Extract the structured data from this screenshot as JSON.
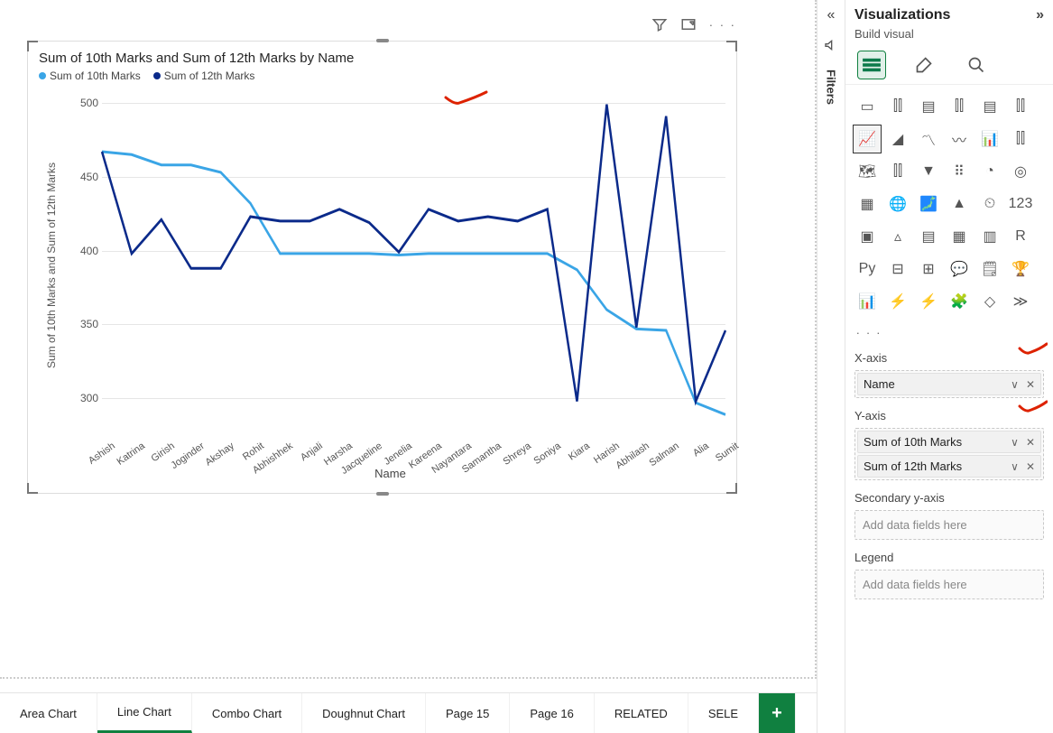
{
  "chart_data": {
    "type": "line",
    "title": "Sum of 10th Marks and Sum of 12th Marks by Name",
    "xlabel": "Name",
    "ylabel": "Sum of 10th Marks and Sum of 12th Marks",
    "ylim": [
      280,
      500
    ],
    "yticks": [
      300,
      350,
      400,
      450,
      500
    ],
    "categories": [
      "Ashish",
      "Katrina",
      "Girish",
      "Joginder",
      "Akshay",
      "Rohit",
      "Abhishhek",
      "Anjali",
      "Harsha",
      "Jacqueline",
      "Jenelia",
      "Kareena",
      "Nayantara",
      "Samantha",
      "Shreya",
      "Soniya",
      "Kiara",
      "Harish",
      "Abhilash",
      "Salman",
      "Alia",
      "Sumit"
    ],
    "series": [
      {
        "name": "Sum of 10th Marks",
        "color": "#3aa5e6",
        "values": [
          467,
          465,
          458,
          458,
          453,
          432,
          398,
          398,
          398,
          398,
          397,
          398,
          398,
          398,
          398,
          398,
          387,
          360,
          347,
          346,
          297,
          289
        ]
      },
      {
        "name": "Sum of 12th Marks",
        "color": "#0b2a8a",
        "values": [
          467,
          398,
          421,
          388,
          388,
          423,
          420,
          420,
          428,
          419,
          399,
          428,
          420,
          423,
          420,
          428,
          298,
          499,
          348,
          491,
          298,
          346
        ]
      }
    ]
  },
  "legend": [
    {
      "label": "Sum of 10th Marks",
      "color": "#3aa5e6"
    },
    {
      "label": "Sum of 12th Marks",
      "color": "#0b2a8a"
    }
  ],
  "tabs": {
    "items": [
      "Area Chart",
      "Line Chart",
      "Combo Chart",
      "Doughnut Chart",
      "Page 15",
      "Page 16",
      "RELATED",
      "SELE"
    ],
    "active": "Line Chart",
    "add": "+"
  },
  "filters_strip": {
    "collapse": "«",
    "icon": "📢",
    "label": "Filters"
  },
  "viz": {
    "title": "Visualizations",
    "expand": "»",
    "subtitle": "Build visual",
    "more": ". . .",
    "gallery": [
      "▭",
      "⫿⫿",
      "▤",
      "⫿⫿",
      "▤",
      "⫿⫿",
      "📈",
      "◢",
      "〽",
      "〰",
      "📊",
      "⫿⫿",
      "🗺",
      "⫿⫿",
      "▼",
      "⠿",
      "◔",
      "◎",
      "▦",
      "🌐",
      "🗾",
      "▲",
      "⏲",
      "123",
      "▣",
      "▵",
      "▤",
      "▦",
      "▥",
      "R",
      "Py",
      "⊟",
      "⊞",
      "💬",
      "🗒",
      "🏆",
      "📊",
      "⚡",
      "⚡",
      "🧩",
      "◇",
      "≫"
    ],
    "selected_gallery_index": 6,
    "fields": {
      "xaxis": {
        "label": "X-axis",
        "pills": [
          {
            "text": "Name"
          }
        ]
      },
      "yaxis": {
        "label": "Y-axis",
        "pills": [
          {
            "text": "Sum of 10th Marks"
          },
          {
            "text": "Sum of 12th Marks"
          }
        ]
      },
      "secy": {
        "label": "Secondary y-axis",
        "placeholder": "Add data fields here"
      },
      "legend": {
        "label": "Legend",
        "placeholder": "Add data fields here"
      }
    },
    "pill_actions": {
      "chevron": "∨",
      "remove": "✕"
    }
  },
  "visual_toolbar": {
    "filter": "⌕",
    "focus": "▣",
    "more": "· · ·"
  }
}
